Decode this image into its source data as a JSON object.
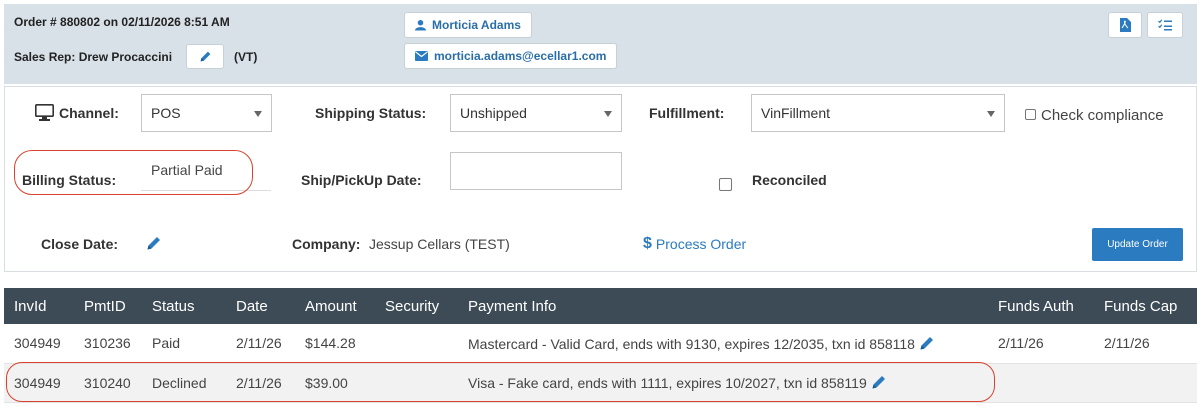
{
  "header": {
    "order_line": "Order # 880802 on 02/11/2026 8:51 AM",
    "sales_rep": "Sales Rep: Drew Procaccini",
    "state": "(VT)",
    "customer_name": "Morticia Adams",
    "customer_email": "morticia.adams@ecellar1.com"
  },
  "form": {
    "channel_label": "Channel:",
    "channel_value": "POS",
    "shipping_status_label": "Shipping Status:",
    "shipping_status_value": "Unshipped",
    "fulfillment_label": "Fulfillment:",
    "fulfillment_value": "VinFillment",
    "check_compliance_label": "Check compliance",
    "billing_status_label": "Billing Status:",
    "billing_status_value": "Partial Paid",
    "ship_date_label": "Ship/PickUp Date:",
    "ship_date_value": "",
    "reconciled_label": "Reconciled",
    "close_date_label": "Close Date:",
    "company_label": "Company:",
    "company_value": "Jessup Cellars (TEST)",
    "process_order_label": "Process Order",
    "update_order_label": "Update Order"
  },
  "payments": {
    "columns": [
      "InvId",
      "PmtID",
      "Status",
      "Date",
      "Amount",
      "Security",
      "Payment Info",
      "Funds Auth",
      "Funds Cap"
    ],
    "rows": [
      [
        "304949",
        "310236",
        "Paid",
        "2/11/26",
        "$144.28",
        "",
        "Mastercard - Valid Card, ends with 9130, expires 12/2035, txn id 858118",
        "2/11/26",
        "2/11/26"
      ],
      [
        "304949",
        "310240",
        "Declined",
        "2/11/26",
        "$39.00",
        "",
        "Visa - Fake card, ends with 1111, expires 10/2027, txn id 858119",
        "",
        ""
      ]
    ]
  },
  "colors": {
    "header_bg": "#d8e0e8",
    "table_header_bg": "#3d4b57",
    "accent": "#2a7bbf",
    "highlight_oval": "#d9412c"
  }
}
